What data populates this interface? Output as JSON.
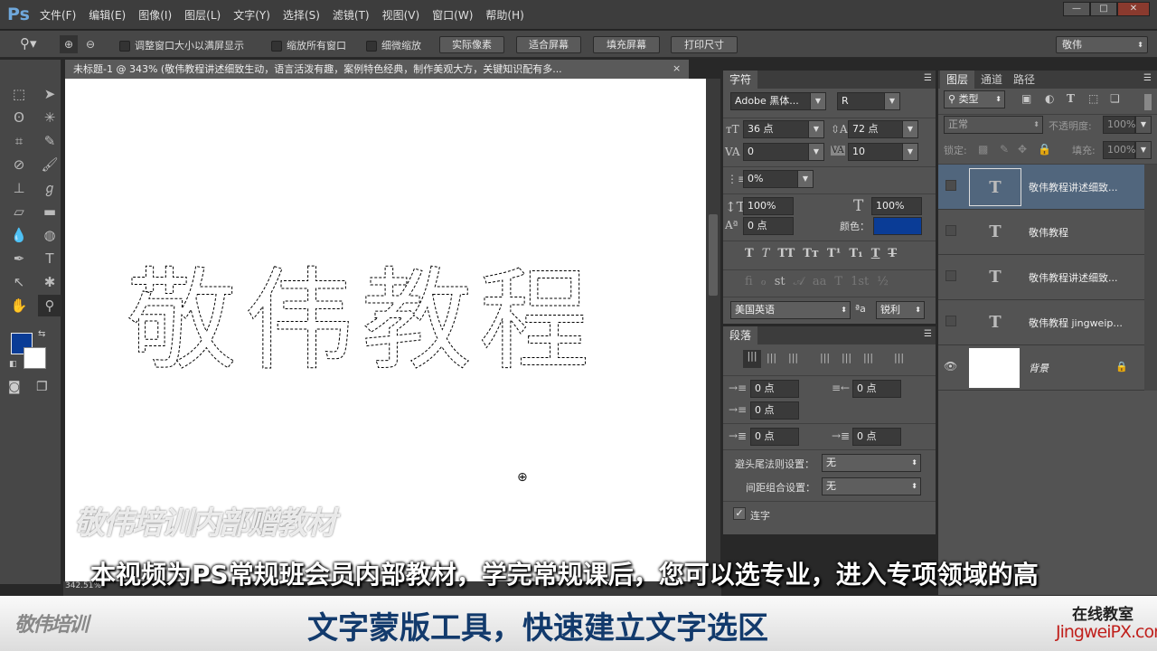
{
  "app": {
    "logo": "Ps",
    "menus": [
      "文件(F)",
      "编辑(E)",
      "图像(I)",
      "图层(L)",
      "文字(Y)",
      "选择(S)",
      "滤镜(T)",
      "视图(V)",
      "窗口(W)",
      "帮助(H)"
    ],
    "window_controls": [
      "—",
      "□",
      "✕"
    ]
  },
  "options": {
    "resize_windows": "调整窗口大小以满屏显示",
    "zoom_all": "缩放所有窗口",
    "scrubby_zoom": "细微缩放",
    "actual_pixels": "实际像素",
    "fit_screen": "适合屏幕",
    "fill_screen": "填充屏幕",
    "print_size": "打印尺寸",
    "workspace": "敬伟"
  },
  "document": {
    "tab_title": "未标题-1 @ 343% (敬伟教程讲述细致生动，语言活泼有趣，案例特色经典，制作美观大方，关键知识配有多...",
    "close": "×",
    "canvas_text": "敬伟教程",
    "zoom_status": "342.51%"
  },
  "colors": {
    "foreground": "#0a3c96",
    "background": "#ffffff",
    "text_color": "#0a3c96"
  },
  "character": {
    "title": "字符",
    "font": "Adobe 黑体...",
    "style": "R",
    "size": "36 点",
    "leading": "72 点",
    "kerning": "0",
    "tracking": "10",
    "tsume": "0%",
    "vscale": "100%",
    "hscale": "100%",
    "baseline": "0 点",
    "color_label": "颜色：",
    "style_buttons": [
      "T",
      "T",
      "TT",
      "Tт",
      "T¹",
      "T₁",
      "T",
      "T"
    ],
    "opentype_buttons": [
      "ﬁ",
      "ℴ",
      "st",
      "𝒜",
      "aa",
      "T",
      "1st",
      "½"
    ],
    "language": "美国英语",
    "aa_icon": "ªa",
    "antialias": "锐利"
  },
  "paragraph": {
    "title": "段落",
    "indent_left": "0 点",
    "indent_right": "0 点",
    "indent_first": "0 点",
    "space_before": "0 点",
    "space_after": "0 点",
    "kinsoku_label": "避头尾法则设置：",
    "kinsoku_value": "无",
    "mojikumi_label": "间距组合设置：",
    "mojikumi_value": "无",
    "hyphenate": "连字"
  },
  "layers": {
    "tabs": [
      "图层",
      "通道",
      "路径"
    ],
    "filter": "类型",
    "blend": "正常",
    "opacity_label": "不透明度:",
    "opacity": "100%",
    "lock_label": "锁定:",
    "fill_label": "填充:",
    "fill": "100%",
    "items": [
      {
        "name": "敬伟教程讲述细致...",
        "thumb": "T"
      },
      {
        "name": "敬伟教程",
        "thumb": "T"
      },
      {
        "name": "敬伟教程讲述细致...",
        "thumb": "T"
      },
      {
        "name": "敬伟教程 jingweip...",
        "thumb": "T"
      },
      {
        "name": "背景",
        "thumb": ""
      }
    ]
  },
  "overlay": {
    "watermark": "敬伟培训内部赠教材",
    "subtitle": "本视频为PS常规班会员内部教材，学完常规课后，您可以选专业，进入专项领域的高"
  },
  "banner": {
    "logo": "敬伟培训",
    "title": "文字蒙版工具，快速建立文字选区",
    "online": "在线教室",
    "site": "JingweiPX.com"
  }
}
